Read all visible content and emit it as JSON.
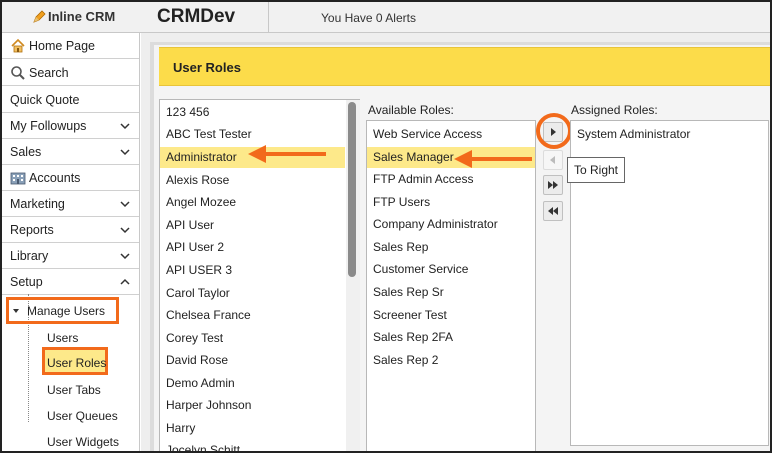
{
  "topbar": {
    "logo_text": "Inline CRM",
    "app_title": "CRMDev",
    "alerts_text": "You Have 0 Alerts"
  },
  "sidebar": {
    "items": [
      {
        "label": "Home Page",
        "icon": "home-icon"
      },
      {
        "label": "Search",
        "icon": "search-icon"
      },
      {
        "label": "Quick Quote"
      },
      {
        "label": "My Followups",
        "chevron": "down"
      },
      {
        "label": "Sales",
        "chevron": "down"
      },
      {
        "label": "Accounts",
        "icon": "building-icon"
      },
      {
        "label": "Marketing",
        "chevron": "down"
      },
      {
        "label": "Reports",
        "chevron": "down"
      },
      {
        "label": "Library",
        "chevron": "down"
      },
      {
        "label": "Setup",
        "chevron": "up"
      }
    ],
    "manage_users": "Manage Users",
    "sub_items": [
      "Users",
      "User Roles",
      "User Tabs",
      "User Queues",
      "User Widgets"
    ]
  },
  "page": {
    "title": "User Roles"
  },
  "users": [
    "123 456",
    "ABC Test Tester",
    "Administrator",
    "Alexis Rose",
    "Angel Mozee",
    "API User",
    "API User 2",
    "API USER 3",
    "Carol Taylor",
    "Chelsea France",
    "Corey Test",
    "David Rose",
    "Demo Admin",
    "Harper Johnson",
    "Harry",
    "Jocelyn Schitt"
  ],
  "selected_user": "Administrator",
  "available": {
    "label": "Available Roles:",
    "roles": [
      "Web Service Access",
      "Sales Manager",
      "FTP Admin Access",
      "FTP Users",
      "Company Administrator",
      "Sales Rep",
      "Customer Service",
      "Sales Rep Sr",
      "Screener Test",
      "Sales Rep 2FA",
      "Sales Rep 2"
    ],
    "selected": "Sales Manager"
  },
  "assigned": {
    "label": "Assigned Roles:",
    "roles": [
      "System Administrator"
    ]
  },
  "tooltip": "To Right",
  "colors": {
    "header_bg": "#fcdc4a",
    "selection_bg": "#fde98a",
    "annotation": "#f26a1b"
  }
}
